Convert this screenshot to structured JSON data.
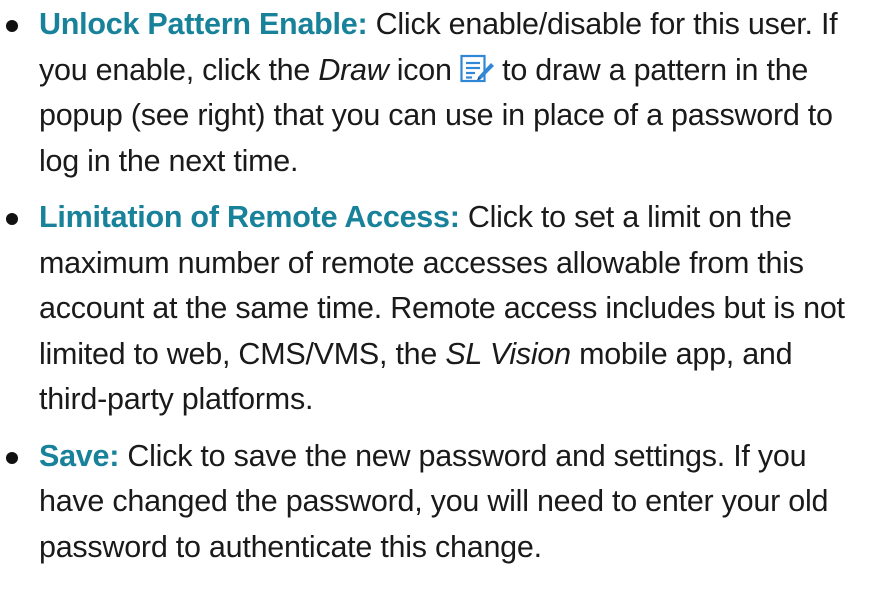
{
  "colors": {
    "term": "#17829a",
    "text": "#1a1a1a",
    "icon_blue": "#2f87d6"
  },
  "items": [
    {
      "term": "Unlock Pattern Enable:",
      "text_before_italic": " Click enable/disable for this user. If you enable, click the ",
      "italic": "Draw",
      "text_after_italic": " icon ",
      "icon": "draw-edit-icon",
      "text_after_icon": " to draw a pattern in the popup (see right) that you can use in place of a password to log in the next time."
    },
    {
      "term": "Limitation of Remote Access:",
      "text_before_italic": " Click to set a limit on the maximum number of remote accesses allowable from this account at the same time. Remote access includes but is not limited to web, CMS/VMS, the ",
      "italic": "SL Vision",
      "text_after_italic": " mobile app, and third-party platforms."
    },
    {
      "term": "Save:",
      "text": " Click to save the new password and settings. If you have changed the password, you will need to enter your old password to authenticate this change."
    }
  ]
}
